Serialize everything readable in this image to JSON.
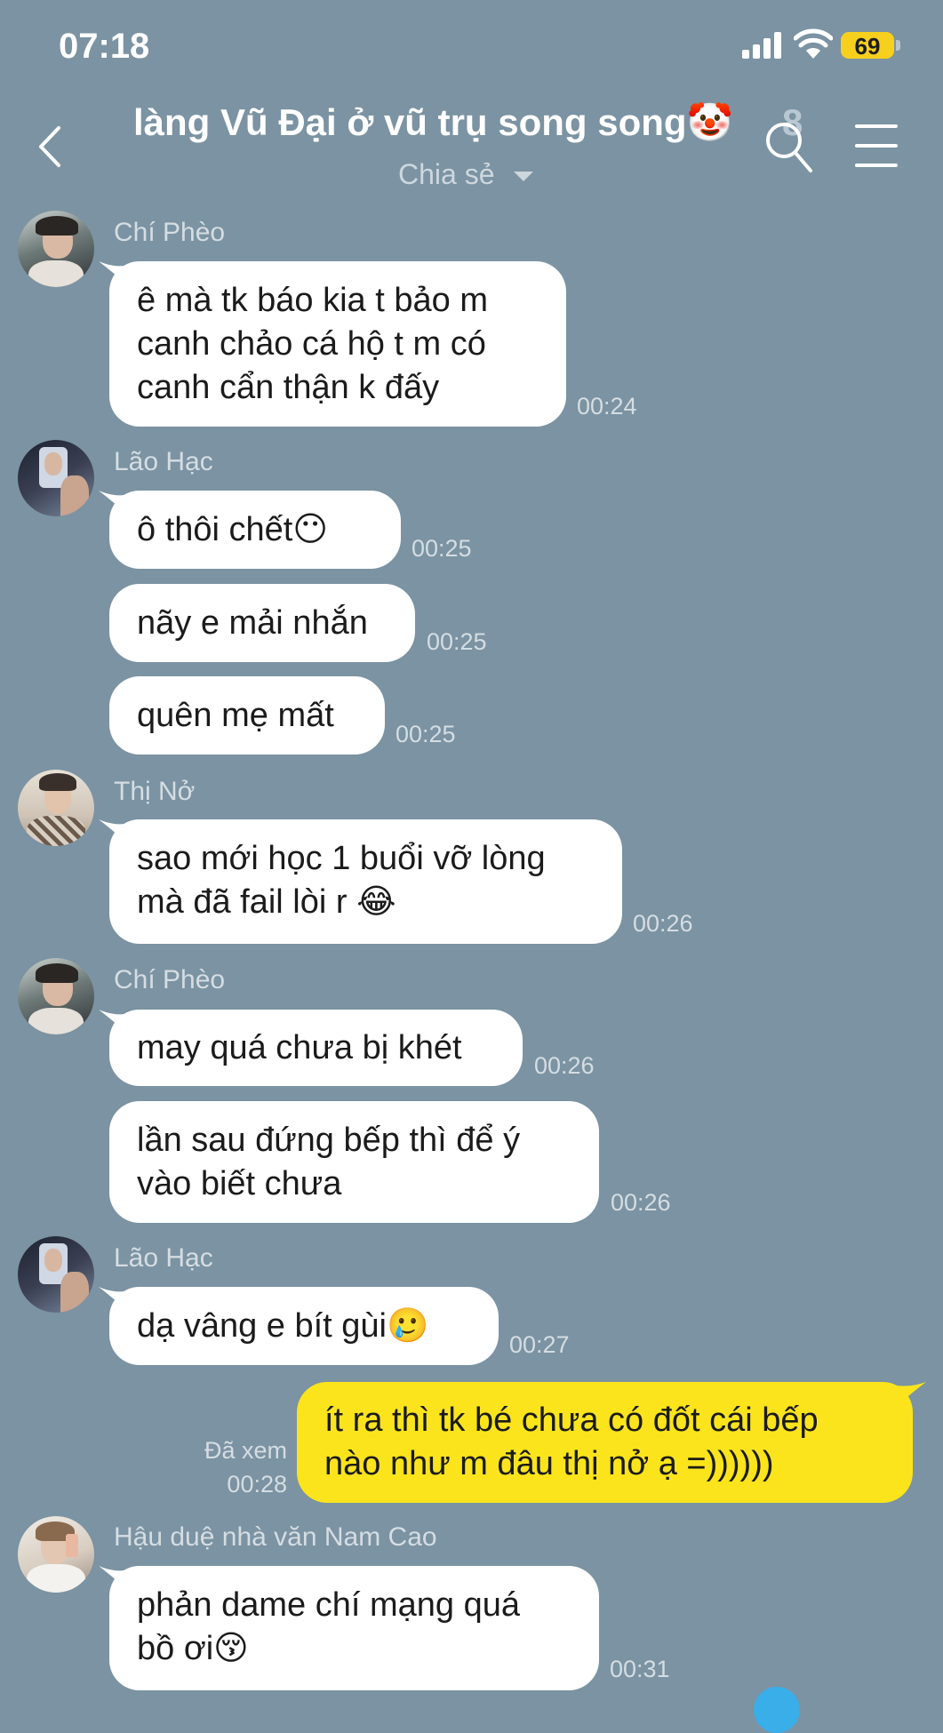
{
  "status_bar": {
    "time": "07:18",
    "battery": "69"
  },
  "header": {
    "title": "làng Vũ Đại ở vũ trụ song song🤡",
    "member_count": "8",
    "subtitle": "Chia sẻ"
  },
  "messages": [
    {
      "sender": "Chí Phèo",
      "lines": [
        "ê mà tk báo kia t bảo m",
        "canh chảo cá hộ t m có",
        "canh cẩn thận k đấy"
      ],
      "time": "00:24"
    },
    {
      "sender": "Lão Hạc",
      "lines": [
        "ô thôi chết😶"
      ],
      "time": "00:25"
    },
    {
      "lines": [
        "nãy e mải nhắn"
      ],
      "time": "00:25"
    },
    {
      "lines": [
        "quên mẹ mất"
      ],
      "time": "00:25"
    },
    {
      "sender": "Thị Nở",
      "lines": [
        "sao mới học 1 buổi vỡ lòng",
        "mà đã fail lòi r 😂"
      ],
      "time": "00:26"
    },
    {
      "sender": "Chí Phèo",
      "lines": [
        "may quá chưa bị khét"
      ],
      "time": "00:26"
    },
    {
      "lines": [
        "lần sau đứng bếp thì để ý",
        "vào biết chưa"
      ],
      "time": "00:26"
    },
    {
      "sender": "Lão Hạc",
      "lines": [
        "dạ vâng e bít gùi🥲"
      ],
      "time": "00:27"
    },
    {
      "lines": [
        "ít ra thì tk bé chưa có đốt cái bếp",
        "nào như m đâu thị nở ạ =))))))"
      ],
      "seen": "Đã xem",
      "time": "00:28"
    },
    {
      "sender": "Hậu duệ nhà văn Nam Cao",
      "lines": [
        "phản dame chí mạng quá",
        "bồ ơi😚"
      ],
      "time": "00:31"
    }
  ],
  "colors": {
    "background": "#7b93a2",
    "my_bubble": "#fbe41c",
    "their_bubble": "#ffffff"
  }
}
